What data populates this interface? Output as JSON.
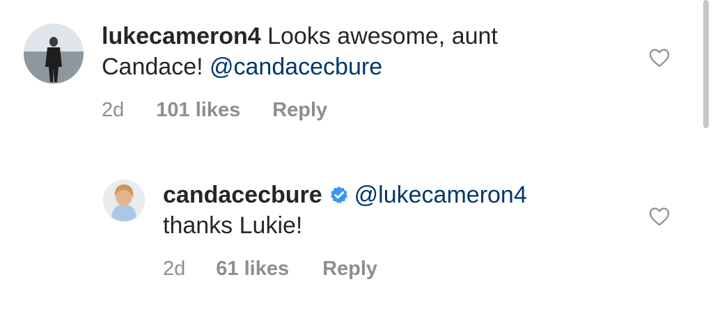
{
  "comments": [
    {
      "username": "lukecameron4",
      "text": " Looks awesome, aunt",
      "text_line2": "Candace! ",
      "mention": "@candacecbure",
      "time": "2d",
      "likes": "101 likes",
      "reply": "Reply"
    },
    {
      "username": "candacecbure",
      "verified": true,
      "mention": "@lukecameron4",
      "text": "thanks  Lukie!",
      "time": "2d",
      "likes": "61 likes",
      "reply": "Reply"
    }
  ],
  "colors": {
    "mention": "#00376b",
    "verified": "#3897f0",
    "meta": "#8e8e8e",
    "text": "#262626"
  },
  "icons": {
    "like": "heart-outline-icon",
    "verified": "verified-badge-icon"
  }
}
